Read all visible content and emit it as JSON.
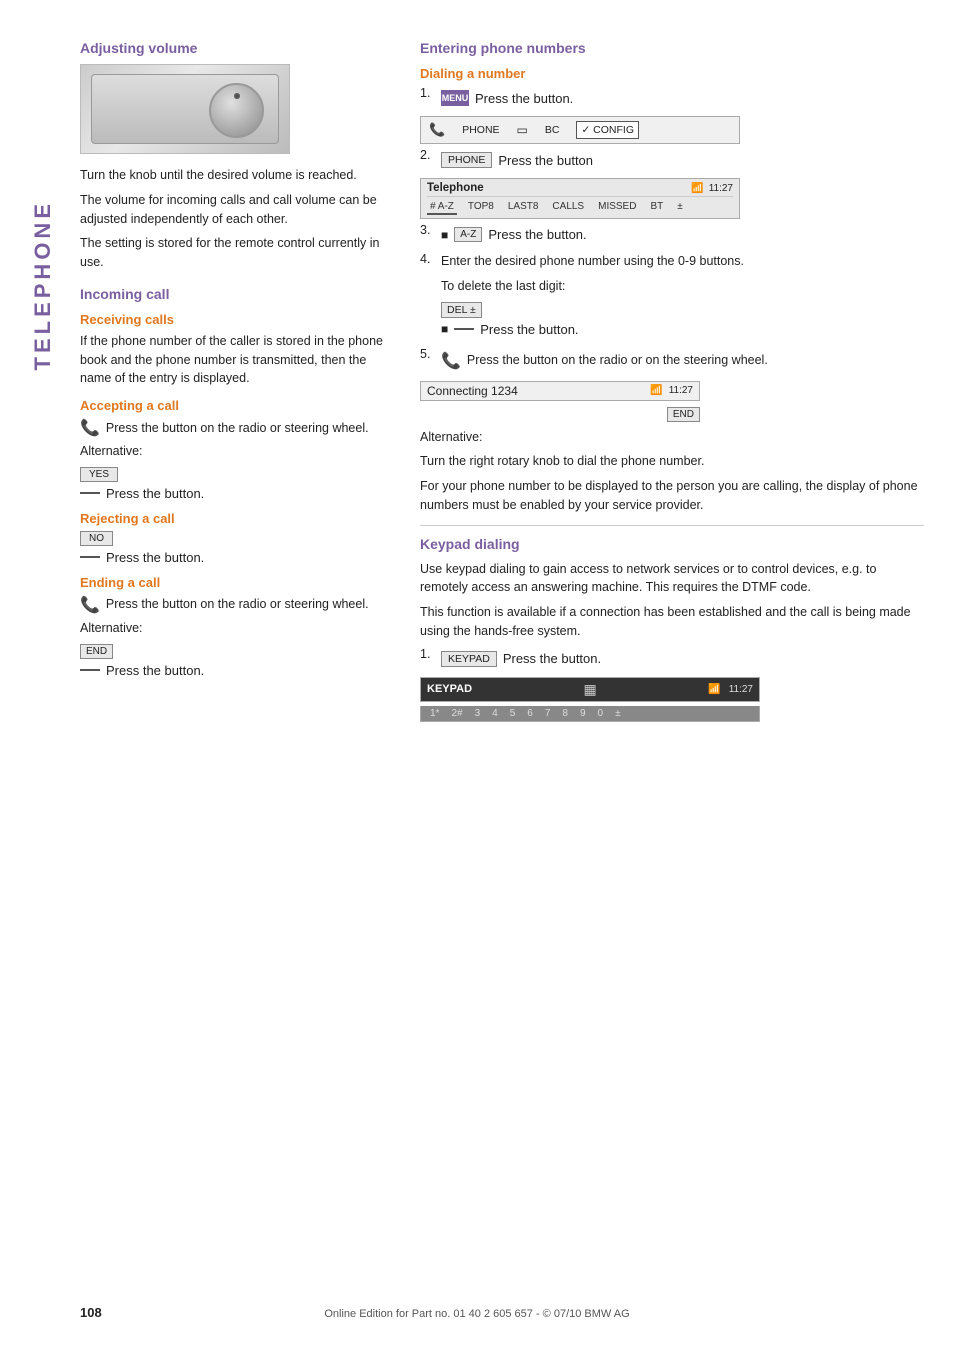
{
  "page": {
    "number": "108",
    "footer": "Online Edition for Part no. 01 40 2 605 657 - © 07/10  BMW AG"
  },
  "sidebar": {
    "label": "TELEPHONE"
  },
  "left_column": {
    "adjusting_volume": {
      "title": "Adjusting volume",
      "paragraphs": [
        "Turn the knob until the desired volume is reached.",
        "The volume for incoming calls and call volume can be adjusted independently of each other.",
        "The setting is stored for the remote control currently in use."
      ]
    },
    "incoming_call": {
      "title": "Incoming call",
      "receiving_calls": {
        "subtitle": "Receiving calls",
        "text": "If the phone number of the caller is stored in the phone book and the phone number is transmitted, then the name of the entry is displayed."
      },
      "accepting_a_call": {
        "subtitle": "Accepting a call",
        "text": "Press the button on the radio or steering wheel.",
        "alternative_label": "Alternative:",
        "yes_button": "YES",
        "press_button_text": "Press the button."
      },
      "rejecting_a_call": {
        "subtitle": "Rejecting a call",
        "no_button": "NO",
        "press_button_text": "Press the button."
      },
      "ending_a_call": {
        "subtitle": "Ending a call",
        "text": "Press the button on the radio or steering wheel.",
        "alternative_label": "Alternative:",
        "end_button": "END",
        "press_button_text": "Press the button."
      }
    }
  },
  "right_column": {
    "entering_phone_numbers": {
      "title": "Entering phone numbers"
    },
    "dialing_a_number": {
      "subtitle": "Dialing a number",
      "step1": {
        "number": "1.",
        "menu_label": "MENU",
        "text": "Press the button."
      },
      "nav_screen": {
        "icon": "📞",
        "items": [
          "PHONE",
          "BC",
          "CONFIG"
        ],
        "active": "CONFIG"
      },
      "step2": {
        "number": "2.",
        "button": "PHONE",
        "text": "Press the button"
      },
      "telephone_screen": {
        "title": "Telephone",
        "signal": "11:27",
        "tabs": [
          "# A-Z",
          "TOP8",
          "LAST8",
          "CALLS",
          "MISSED",
          "BT",
          "±"
        ]
      },
      "step3": {
        "number": "3.",
        "button": "# A-Z",
        "text": "Press the button."
      },
      "step4": {
        "number": "4.",
        "text": "Enter the desired phone number using the 0-9 buttons.",
        "delete_label": "To delete the last digit:",
        "del_button": "DEL ±",
        "del_text": "Press the button."
      },
      "step5": {
        "number": "5.",
        "text": "Press the button on the radio or on the steering wheel."
      },
      "connecting_screen": {
        "text": "Connecting 1234",
        "signal": "11:27",
        "end_button": "END"
      },
      "alternative_label": "Alternative:",
      "alternative_text": "Turn the right rotary knob to dial the phone number.",
      "display_info": "For your phone number to be displayed to the person you are calling, the display of phone numbers must be enabled by your service provider."
    },
    "keypad_dialing": {
      "title": "Keypad dialing",
      "paragraphs": [
        "Use keypad dialing to gain access to network services or to control devices, e.g. to remotely access an answering machine. This requires the DTMF code.",
        "This function is available if a connection has been established and the call is being made using the hands-free system."
      ],
      "step1": {
        "number": "1.",
        "button": "KEYPAD",
        "text": "Press the button."
      },
      "keypad_screen_top": {
        "title": "KEYPAD",
        "signal": "11:27",
        "icon": "▦"
      },
      "keypad_screen_bottom": {
        "keys": [
          "1*",
          "2#",
          "3",
          "4",
          "5",
          "6",
          "7",
          "8",
          "9",
          "0",
          "±"
        ]
      }
    }
  }
}
